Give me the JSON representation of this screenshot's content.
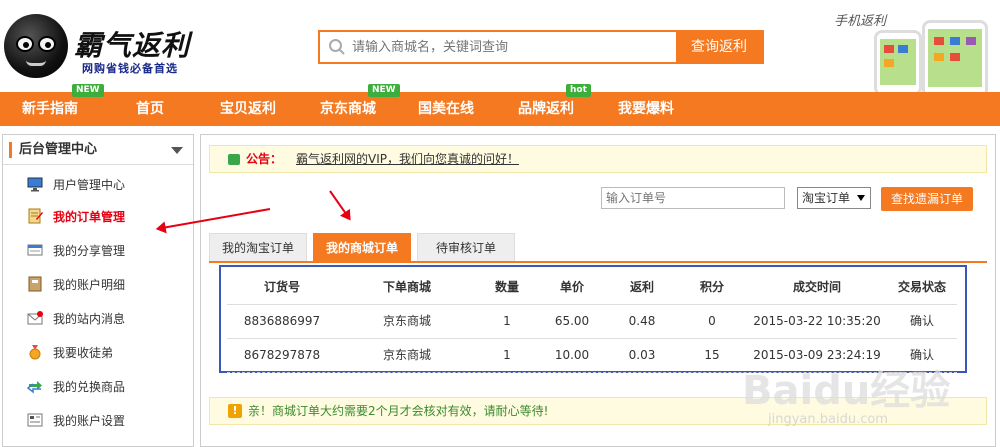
{
  "header": {
    "logo_title": "霸气返利",
    "logo_subtitle": "网购省钱必备首选",
    "search_placeholder": "请输入商城名，关键词查询",
    "search_button": "查询返利",
    "mobile_label": "手机返利"
  },
  "nav": {
    "items": [
      {
        "label": "新手指南",
        "badge": "NEW"
      },
      {
        "label": "首页",
        "badge": ""
      },
      {
        "label": "宝贝返利",
        "badge": ""
      },
      {
        "label": "京东商城",
        "badge": "NEW"
      },
      {
        "label": "国美在线",
        "badge": ""
      },
      {
        "label": "品牌返利",
        "badge": "hot"
      },
      {
        "label": "我要爆料",
        "badge": ""
      }
    ]
  },
  "sidebar": {
    "title": "后台管理中心",
    "items": [
      {
        "label": "用户管理中心",
        "icon": "monitor-icon"
      },
      {
        "label": "我的订单管理",
        "icon": "order-icon"
      },
      {
        "label": "我的分享管理",
        "icon": "share-icon"
      },
      {
        "label": "我的账户明细",
        "icon": "ledger-icon"
      },
      {
        "label": "我的站内消息",
        "icon": "mail-icon"
      },
      {
        "label": "我要收徒弟",
        "icon": "medal-icon"
      },
      {
        "label": "我的兑换商品",
        "icon": "exchange-icon"
      },
      {
        "label": "我的账户设置",
        "icon": "settings-icon"
      }
    ]
  },
  "main": {
    "notice_label": "公告：",
    "notice_text": "霸气返利网的VIP，我们向您真诚的问好！",
    "order_placeholder": "输入订单号",
    "order_select": "淘宝订单",
    "find_button": "查找遗漏订单",
    "tabs": [
      "我的淘宝订单",
      "我的商城订单",
      "待审核订单"
    ],
    "table": {
      "headers": [
        "订货号",
        "下单商城",
        "数量",
        "单价",
        "返利",
        "积分",
        "成交时间",
        "交易状态"
      ],
      "rows": [
        [
          "8836886997",
          "京东商城",
          "1",
          "65.00",
          "0.48",
          "0",
          "2015-03-22 10:35:20",
          "确认"
        ],
        [
          "8678297878",
          "京东商城",
          "1",
          "10.00",
          "0.03",
          "15",
          "2015-03-09 23:24:19",
          "确认"
        ]
      ]
    },
    "tip_text": "亲！商城订单大约需要2个月才会核对有效，请耐心等待!"
  },
  "watermark": {
    "text": "Baidu经验",
    "url": "jingyan.baidu.com"
  },
  "colors": {
    "accent": "#f47920",
    "highlight": "#e60012",
    "table_border": "#3a57b5",
    "badge": "#3cae3c"
  }
}
